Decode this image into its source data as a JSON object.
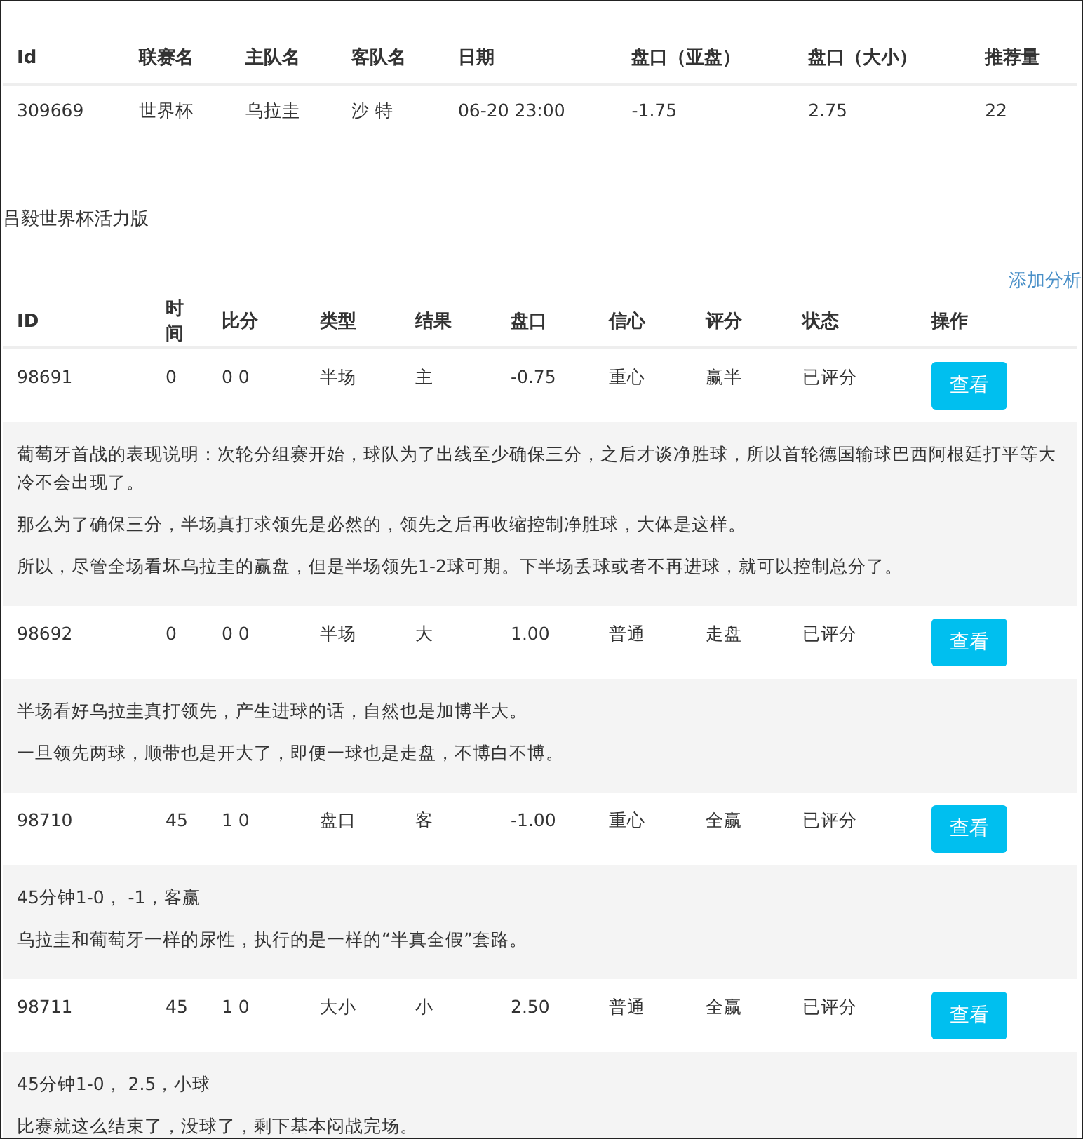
{
  "match_table": {
    "columns": [
      "Id",
      "联赛名",
      "主队名",
      "客队名",
      "日期",
      "盘口（亚盘）",
      "盘口（大小）",
      "推荐量"
    ],
    "rows": [
      [
        "309669",
        "世界杯",
        "乌拉圭",
        "沙 特",
        "06-20 23:00",
        "-1.75",
        "2.75",
        "22"
      ]
    ]
  },
  "title": "吕毅世界杯活力版",
  "add_link": "添加分析",
  "analysis_table": {
    "columns": [
      "ID",
      "时间",
      "比分",
      "类型",
      "结果",
      "盘口",
      "信心",
      "评分",
      "状态",
      "操作"
    ],
    "rows": [
      {
        "cells": [
          "98691",
          "0",
          "0 0",
          "半场",
          "主",
          "-0.75",
          "重心",
          "赢半",
          "已评分"
        ],
        "button": "查看",
        "notes": [
          "葡萄牙首战的表现说明：次轮分组赛开始，球队为了出线至少确保三分，之后才谈净胜球，所以首轮德国输球巴西阿根廷打平等大冷不会出现了。",
          "那么为了确保三分，半场真打求领先是必然的，领先之后再收缩控制净胜球，大体是这样。",
          "所以，尽管全场看坏乌拉圭的赢盘，但是半场领先1-2球可期。下半场丢球或者不再进球，就可以控制总分了。"
        ]
      },
      {
        "cells": [
          "98692",
          "0",
          "0 0",
          "半场",
          "大",
          "1.00",
          "普通",
          "走盘",
          "已评分"
        ],
        "button": "查看",
        "notes": [
          "半场看好乌拉圭真打领先，产生进球的话，自然也是加博半大。",
          "一旦领先两球，顺带也是开大了，即便一球也是走盘，不博白不博。"
        ]
      },
      {
        "cells": [
          "98710",
          "45",
          "1 0",
          "盘口",
          "客",
          "-1.00",
          "重心",
          "全赢",
          "已评分"
        ],
        "button": "查看",
        "notes": [
          "45分钟1-0， -1，客赢",
          "乌拉圭和葡萄牙一样的尿性，执行的是一样的“半真全假”套路。"
        ]
      },
      {
        "cells": [
          "98711",
          "45",
          "1 0",
          "大小",
          "小",
          "2.50",
          "普通",
          "全赢",
          "已评分"
        ],
        "button": "查看",
        "notes": [
          "45分钟1-0， 2.5，小球",
          "比赛就这么结束了，没球了，剩下基本闷战完场。"
        ]
      }
    ]
  }
}
